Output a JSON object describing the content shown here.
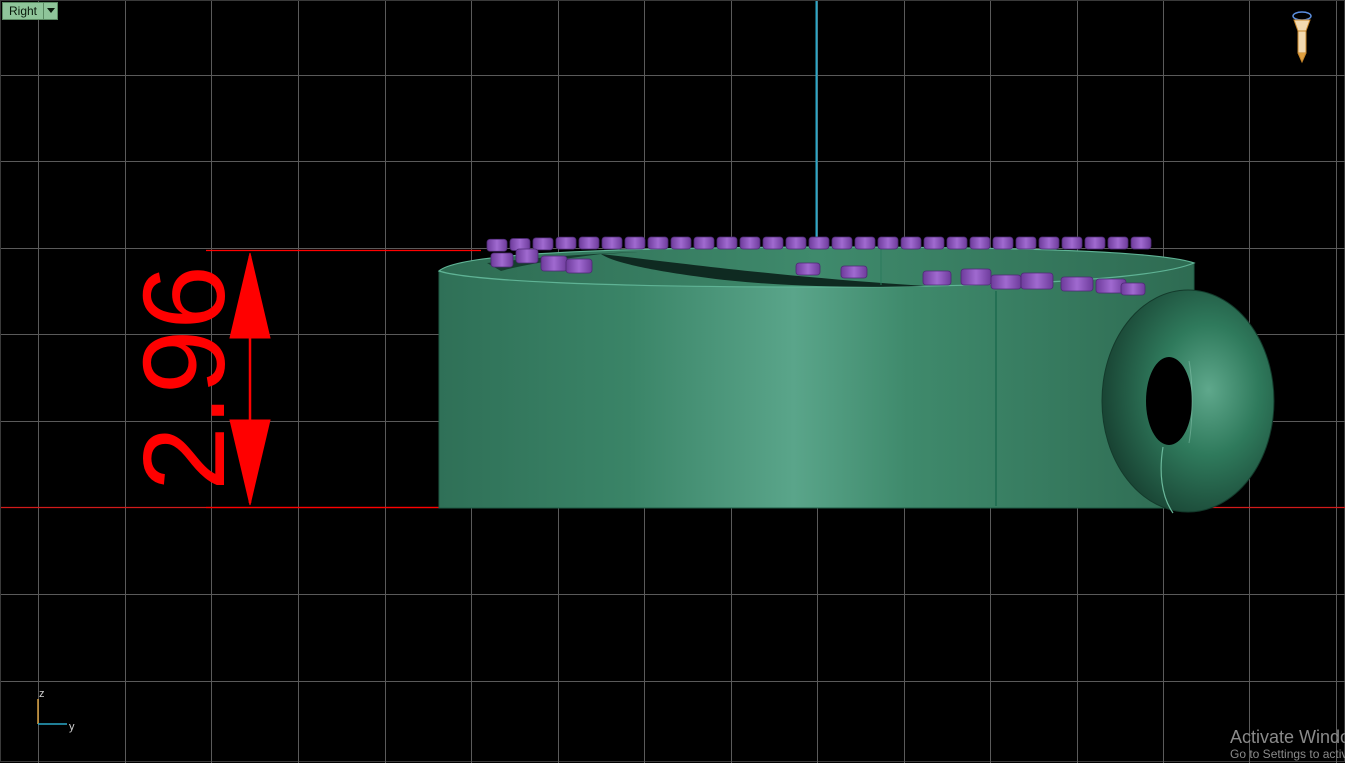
{
  "viewport": {
    "name": "Right",
    "dropdown_icon": "chevron-down-icon"
  },
  "dimension": {
    "value": "2.96",
    "color": "#ff0000"
  },
  "axes": {
    "vertical": "z",
    "horizontal": "y"
  },
  "watermark": {
    "title": "Activate Windows",
    "subtitle": "Go to Settings to activate Windows."
  },
  "colors": {
    "background": "#000000",
    "grid": "#5a5a5a",
    "ground_line": "#d21a1a",
    "vertical_axis": "#2aa7c8",
    "body_green": "#3f8c6e",
    "stone_purple": "#9058c0"
  },
  "icons": [
    "camera-lens-icon",
    "axis-gizmo-icon",
    "chevron-down-icon"
  ]
}
